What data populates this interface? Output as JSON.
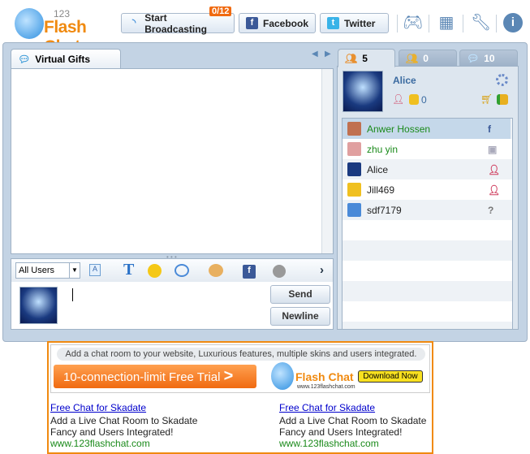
{
  "header": {
    "logo_number": "123",
    "logo_text": "Flash Chat",
    "broadcast_label": "Start Broadcasting",
    "broadcast_badge": "0/12",
    "facebook_label": "Facebook",
    "twitter_label": "Twitter",
    "icons": [
      "gamepad-icon",
      "gift-icon",
      "wrench-icon",
      "info-icon"
    ]
  },
  "left": {
    "tab_label": "Virtual Gifts",
    "toolbar": {
      "recipient": "All Users"
    },
    "send_label": "Send",
    "newline_label": "Newline"
  },
  "right": {
    "tabs": [
      {
        "icon": "users-icon",
        "count": "5"
      },
      {
        "icon": "add-users-icon",
        "count": "0"
      },
      {
        "icon": "chat-bubble-icon",
        "count": "10"
      }
    ],
    "profile": {
      "name": "Alice",
      "coins": "0"
    },
    "users": [
      {
        "name": "Anwer Hossen",
        "color": "#1a8a1a",
        "badge": "facebook"
      },
      {
        "name": "zhu yin",
        "color": "#1a8a1a",
        "badge": "image"
      },
      {
        "name": "Alice",
        "color": "#222",
        "badge": "female"
      },
      {
        "name": "Jill469",
        "color": "#222",
        "badge": "female"
      },
      {
        "name": "sdf7179",
        "color": "#222",
        "badge": "unknown"
      }
    ]
  },
  "ad": {
    "tagline": "Add a chat room to your website, Luxurious features, multiple skins and users integrated.",
    "trial": "10-connection-limit Free Trial",
    "logo_url": "www.123flashchat.com",
    "download": "Download Now",
    "cols": [
      {
        "link": "Free Chat for Skadate",
        "line1": "Add a Live Chat Room to Skadate",
        "line2": "Fancy and Users Integrated!",
        "url": "www.123flashchat.com"
      },
      {
        "link": "Free Chat for Skadate",
        "line1": "Add a Live Chat Room to Skadate",
        "line2": "Fancy and Users Integrated!",
        "url": "www.123flashchat.com"
      }
    ]
  }
}
